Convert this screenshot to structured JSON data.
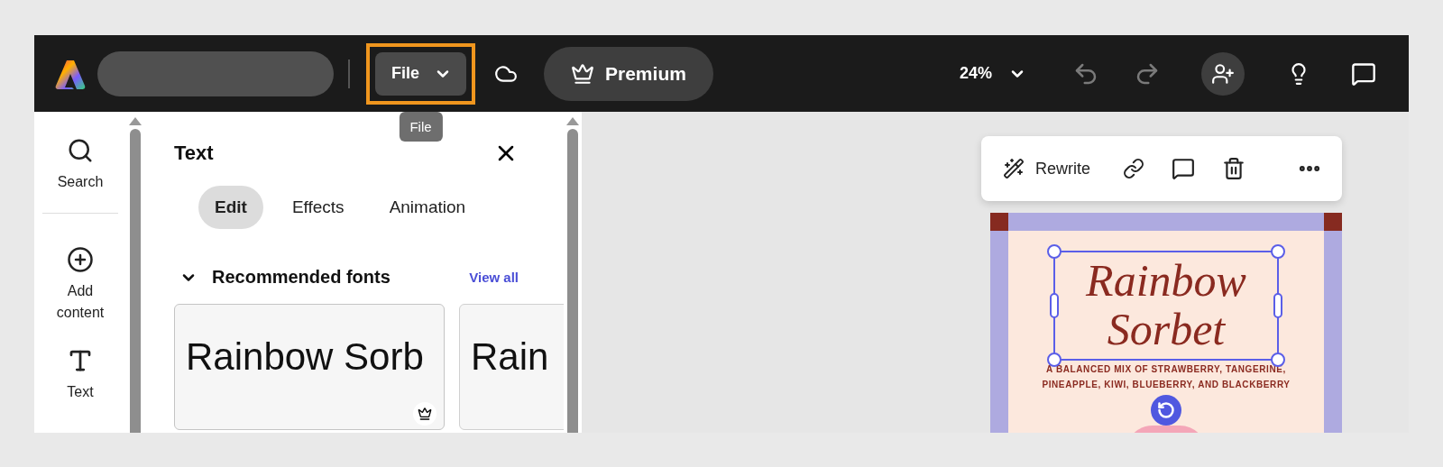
{
  "top_bar": {
    "file_menu": {
      "label": "File",
      "highlighted": true
    },
    "tooltip": "File",
    "premium_button": "Premium",
    "zoom": "24%",
    "undo_enabled": false,
    "redo_enabled": false
  },
  "rail": [
    {
      "label": "Search"
    },
    {
      "label": "Add content"
    },
    {
      "label": "Text"
    }
  ],
  "panel": {
    "title": "Text",
    "tabs": [
      {
        "label": "Edit",
        "selected": true
      },
      {
        "label": "Effects",
        "selected": false
      },
      {
        "label": "Animation",
        "selected": false
      }
    ],
    "section": {
      "title": "Recommended fonts",
      "expanded": true,
      "link": "View all"
    },
    "font_samples": [
      {
        "sample": "Rainbow Sorb",
        "premium": true
      },
      {
        "sample": "Rain",
        "premium": false
      }
    ]
  },
  "context_toolbar": {
    "rewrite": "Rewrite"
  },
  "poster": {
    "title": "Rainbow Sorbet",
    "subtitle_lines": [
      "A BALANCED MIX OF STRAWBERRY, TANGERINE,",
      "PINEAPPLE, KIWI, BLUEBERRY, AND BLACKBERRY"
    ],
    "selected": true
  }
}
